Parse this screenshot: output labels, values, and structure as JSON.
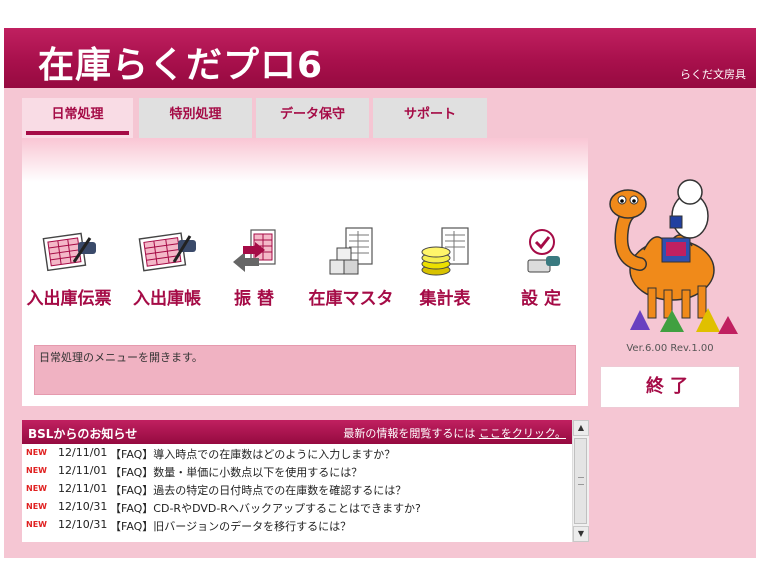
{
  "app": {
    "title": "在庫らくだプロ6",
    "company": "らくだ文房具"
  },
  "tabs": [
    {
      "label": "日常処理",
      "active": true
    },
    {
      "label": "特別処理",
      "active": false
    },
    {
      "label": "データ保守",
      "active": false
    },
    {
      "label": "サポート",
      "active": false
    }
  ],
  "menu": {
    "items": [
      {
        "label": "入出庫伝票",
        "icon": "slip-pen-icon"
      },
      {
        "label": "入出庫帳",
        "icon": "ledger-pen-icon"
      },
      {
        "label": "振 替",
        "icon": "transfer-icon"
      },
      {
        "label": "在庫マスタ",
        "icon": "stock-boxes-icon"
      },
      {
        "label": "集計表",
        "icon": "coins-sheet-icon"
      },
      {
        "label": "設 定",
        "icon": "settings-check-icon"
      }
    ],
    "description": "日常処理のメニューを開きます。"
  },
  "side": {
    "version": "Ver.6.00 Rev.1.00",
    "exit_label": "終了",
    "mascot": "camel-mascot-icon"
  },
  "news": {
    "title": "BSLからのお知らせ",
    "prompt": "最新の情報を閲覧するには",
    "link": "ここをクリック。",
    "items": [
      {
        "badge": "NEW",
        "date": "12/11/01",
        "text": "【FAQ】導入時点での在庫数はどのように入力しますか？"
      },
      {
        "badge": "NEW",
        "date": "12/11/01",
        "text": "【FAQ】数量・単価に小数点以下を使用するには？"
      },
      {
        "badge": "NEW",
        "date": "12/11/01",
        "text": "【FAQ】過去の特定の日付時点での在庫数を確認するには？"
      },
      {
        "badge": "NEW",
        "date": "12/10/31",
        "text": "【FAQ】CD-RやDVD-Rへバックアップすることはできますか?"
      },
      {
        "badge": "NEW",
        "date": "12/10/31",
        "text": "【FAQ】旧バージョンのデータを移行するには？"
      }
    ]
  },
  "colors": {
    "brand": "#a50b46",
    "panel": "#f5c6d3",
    "description_bg": "#f0b2c2"
  }
}
